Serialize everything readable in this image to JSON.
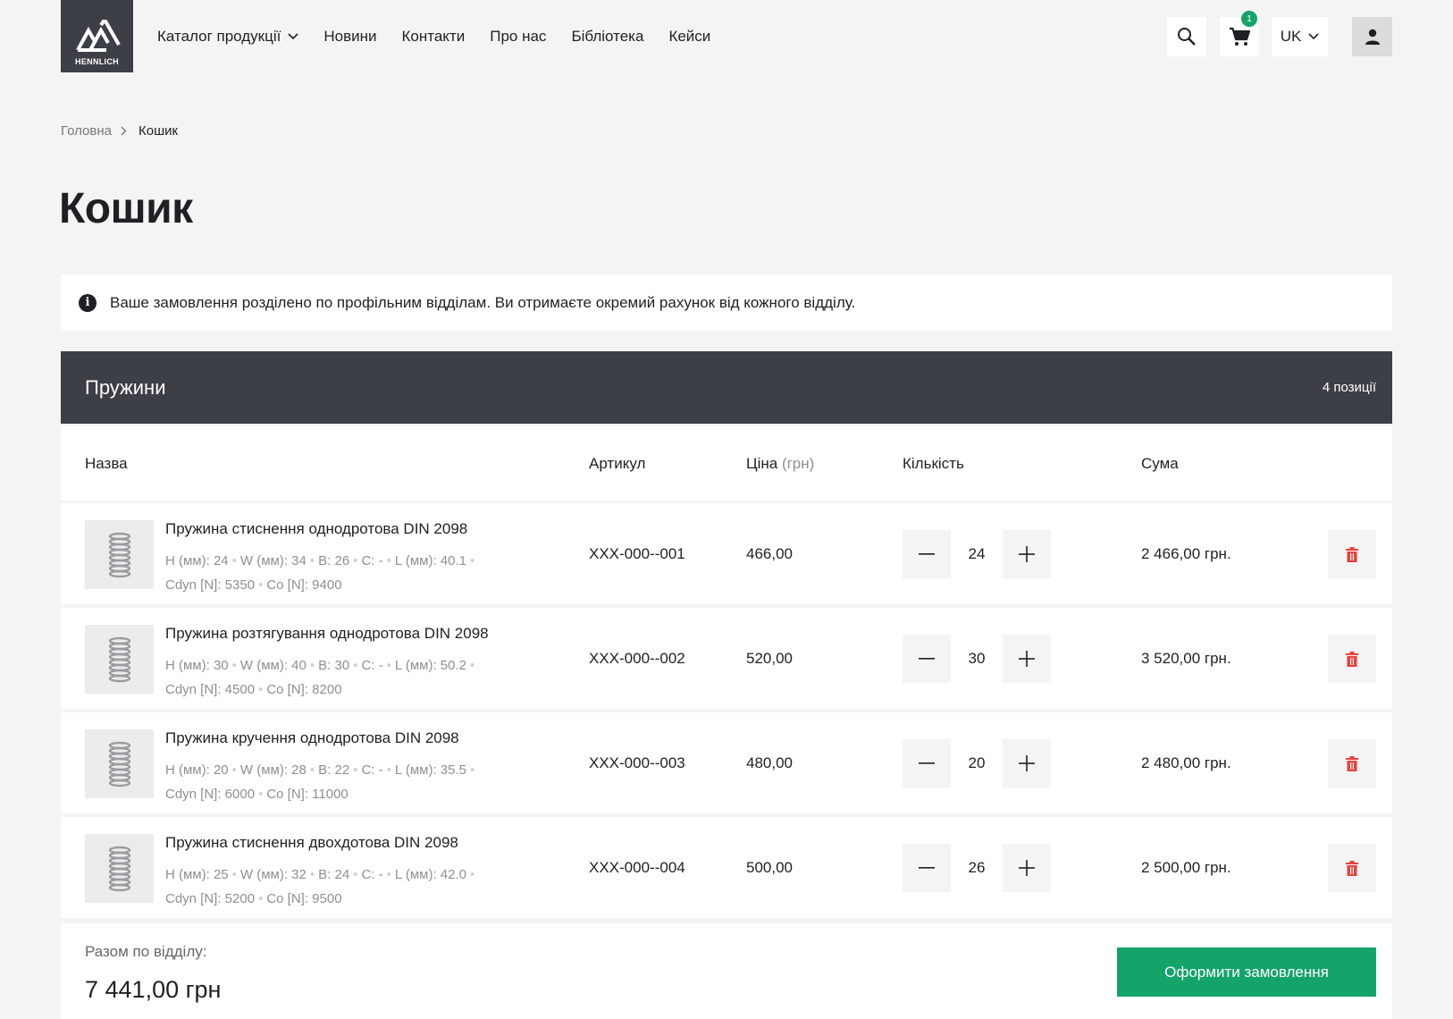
{
  "header": {
    "logo_text": "HENNLICH",
    "nav": [
      {
        "label": "Каталог продукції"
      },
      {
        "label": "Новини"
      },
      {
        "label": "Контакти"
      },
      {
        "label": "Про нас"
      },
      {
        "label": "Бібліотека"
      },
      {
        "label": "Кейси"
      }
    ],
    "cart_count": "1",
    "language": "UK"
  },
  "breadcrumb": {
    "home": "Головна",
    "current": "Кошик"
  },
  "page_title": "Кошик",
  "info_text": "Ваше замовлення розділено по профільним відділам. Ви отримаєте окремий рахунок від кожного відділу.",
  "group": {
    "title": "Пружини",
    "count": "4 позиції",
    "columns": {
      "name": "Назва",
      "sku": "Артикул",
      "price": "Ціна",
      "price_unit": "(грн)",
      "qty": "Кількість",
      "sum": "Сума"
    },
    "items": [
      {
        "name": "Пружина стиснення однодротова DIN 2098",
        "h": "H (мм): 24",
        "w": "W (мм): 34",
        "b": "B: 26",
        "c": "C: -",
        "l": "L (мм): 40.1",
        "cdyn": "Cdyn [N]: 5350",
        "co": "Co [N]: 9400",
        "sku": "XXX-000--001",
        "price": "466,00",
        "qty": "24",
        "sum": "2 466,00 грн."
      },
      {
        "name": "Пружина розтягування однодротова DIN 2098",
        "h": "H (мм): 30",
        "w": "W (мм): 40",
        "b": "B: 30",
        "c": "C: -",
        "l": "L (мм): 50.2",
        "cdyn": "Cdyn [N]: 4500",
        "co": "Co [N]: 8200",
        "sku": "XXX-000--002",
        "price": "520,00",
        "qty": "30",
        "sum": "3 520,00 грн."
      },
      {
        "name": "Пружина кручення однодротова DIN 2098",
        "h": "H (мм): 20",
        "w": "W (мм): 28",
        "b": "B: 22",
        "c": "C: -",
        "l": "L (мм): 35.5",
        "cdyn": "Cdyn [N]: 6000",
        "co": "Co [N]: 11000",
        "sku": "XXX-000--003",
        "price": "480,00",
        "qty": "20",
        "sum": "2 480,00 грн."
      },
      {
        "name": "Пружина стиснення двохдотова DIN 2098",
        "h": "H (мм): 25",
        "w": "W (мм): 32",
        "b": "B: 24",
        "c": "C: -",
        "l": "L (мм): 42.0",
        "cdyn": "Cdyn [N]: 5200",
        "co": "Co [N]: 9500",
        "sku": "XXX-000--004",
        "price": "500,00",
        "qty": "26",
        "sum": "2 500,00 грн."
      }
    ]
  },
  "footer": {
    "total_label": "Разом по відділу:",
    "total_value": "7 441,00 грн",
    "checkout_label": "Оформити замовлення"
  },
  "colors": {
    "dark": "#3c4046",
    "accent_green": "#14a46a",
    "delete_red": "#e8413b",
    "background": "#f4f4f4"
  },
  "icons": [
    "hennlich-logo",
    "chevron-down-icon",
    "search-icon",
    "cart-icon",
    "user-icon",
    "chevron-right-icon",
    "info-icon",
    "spring-image",
    "minus-icon",
    "plus-icon",
    "trash-icon"
  ]
}
